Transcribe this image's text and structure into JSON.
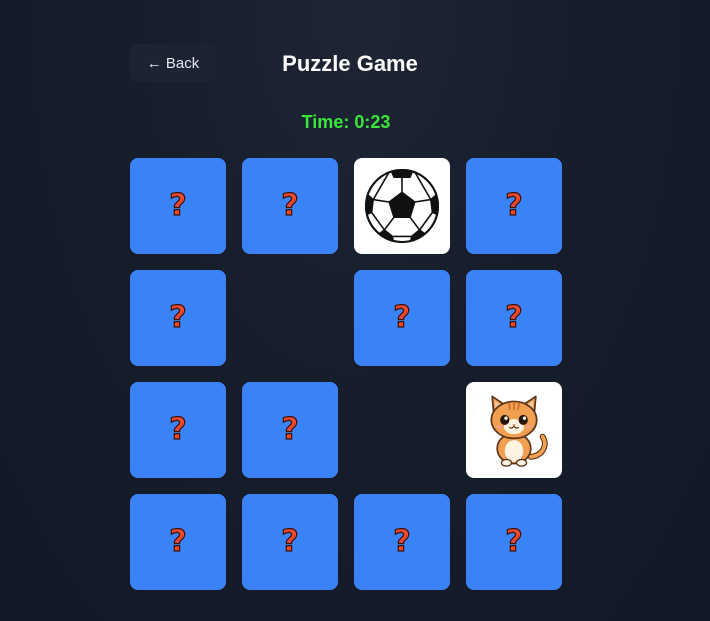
{
  "header": {
    "back_label": "← Back",
    "title": "Puzzle Game"
  },
  "timer": {
    "text": "Time: 0:23"
  },
  "colors": {
    "card_back": "#3b82f6",
    "timer": "#39e639",
    "background": "#141b29"
  },
  "board": {
    "rows": 4,
    "cols": 4,
    "cards": [
      {
        "state": "hidden",
        "symbol": "?"
      },
      {
        "state": "hidden",
        "symbol": "?"
      },
      {
        "state": "revealed",
        "icon": "soccer-ball-icon"
      },
      {
        "state": "hidden",
        "symbol": "?"
      },
      {
        "state": "hidden",
        "symbol": "?"
      },
      {
        "state": "removed"
      },
      {
        "state": "hidden",
        "symbol": "?"
      },
      {
        "state": "hidden",
        "symbol": "?"
      },
      {
        "state": "hidden",
        "symbol": "?"
      },
      {
        "state": "hidden",
        "symbol": "?"
      },
      {
        "state": "removed"
      },
      {
        "state": "revealed",
        "icon": "cat-icon"
      },
      {
        "state": "hidden",
        "symbol": "?"
      },
      {
        "state": "hidden",
        "symbol": "?"
      },
      {
        "state": "hidden",
        "symbol": "?"
      },
      {
        "state": "hidden",
        "symbol": "?"
      }
    ]
  }
}
